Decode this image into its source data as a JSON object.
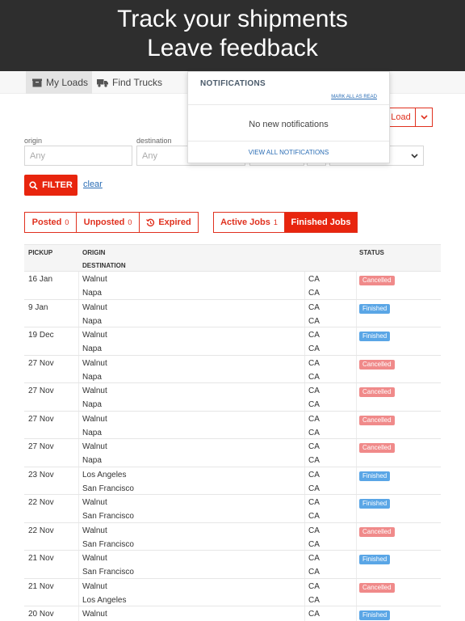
{
  "banner": {
    "line1": "Track your shipments",
    "line2": "Leave feedback"
  },
  "nav": {
    "my_loads": "My Loads",
    "find_trucks": "Find Trucks"
  },
  "actions": {
    "load_label": "Load"
  },
  "filters": {
    "origin_label": "origin",
    "destination_label": "destination",
    "origin_placeholder": "Any",
    "destination_placeholder": "Any",
    "filter_label": "FILTER",
    "clear_label": "clear"
  },
  "notifications": {
    "title": "NOTIFICATIONS",
    "mark_all": "MARK ALL AS READ",
    "empty": "No new notifications",
    "view_all": "VIEW ALL NOTIFICATIONS"
  },
  "status_tabs": [
    {
      "label": "Posted",
      "count": "0"
    },
    {
      "label": "Unposted",
      "count": "0"
    },
    {
      "label": "Expired",
      "count": ""
    }
  ],
  "job_tabs": [
    {
      "label": "Active Jobs",
      "count": "1"
    },
    {
      "label": "Finished Jobs",
      "count": ""
    }
  ],
  "table": {
    "headers": {
      "pickup": "PICKUP",
      "origin": "ORIGIN",
      "destination": "DESTINATION",
      "status": "STATUS"
    },
    "rows": [
      {
        "date": "16 Jan",
        "origin": "Walnut",
        "origin_state": "CA",
        "dest": "Napa",
        "dest_state": "CA",
        "status": "Cancelled"
      },
      {
        "date": "9 Jan",
        "origin": "Walnut",
        "origin_state": "CA",
        "dest": "Napa",
        "dest_state": "CA",
        "status": "Finished"
      },
      {
        "date": "19 Dec",
        "origin": "Walnut",
        "origin_state": "CA",
        "dest": "Napa",
        "dest_state": "CA",
        "status": "Finished"
      },
      {
        "date": "27 Nov",
        "origin": "Walnut",
        "origin_state": "CA",
        "dest": "Napa",
        "dest_state": "CA",
        "status": "Cancelled"
      },
      {
        "date": "27 Nov",
        "origin": "Walnut",
        "origin_state": "CA",
        "dest": "Napa",
        "dest_state": "CA",
        "status": "Cancelled"
      },
      {
        "date": "27 Nov",
        "origin": "Walnut",
        "origin_state": "CA",
        "dest": "Napa",
        "dest_state": "CA",
        "status": "Cancelled"
      },
      {
        "date": "27 Nov",
        "origin": "Walnut",
        "origin_state": "CA",
        "dest": "Napa",
        "dest_state": "CA",
        "status": "Cancelled"
      },
      {
        "date": "23 Nov",
        "origin": "Los Angeles",
        "origin_state": "CA",
        "dest": "San Francisco",
        "dest_state": "CA",
        "status": "Finished"
      },
      {
        "date": "22 Nov",
        "origin": "Walnut",
        "origin_state": "CA",
        "dest": "San Francisco",
        "dest_state": "CA",
        "status": "Finished"
      },
      {
        "date": "22 Nov",
        "origin": "Walnut",
        "origin_state": "CA",
        "dest": "San Francisco",
        "dest_state": "CA",
        "status": "Cancelled"
      },
      {
        "date": "21 Nov",
        "origin": "Walnut",
        "origin_state": "CA",
        "dest": "San Francisco",
        "dest_state": "CA",
        "status": "Finished"
      },
      {
        "date": "21 Nov",
        "origin": "Walnut",
        "origin_state": "CA",
        "dest": "Los Angeles",
        "dest_state": "CA",
        "status": "Cancelled"
      },
      {
        "date": "20 Nov",
        "origin": "Walnut",
        "origin_state": "CA",
        "dest": "",
        "dest_state": "",
        "status": "Finished"
      }
    ]
  },
  "colors": {
    "accent": "#e8250e",
    "cancelled": "#f08a8a",
    "finished": "#5aa6e6",
    "banner": "#2e2e2e"
  }
}
